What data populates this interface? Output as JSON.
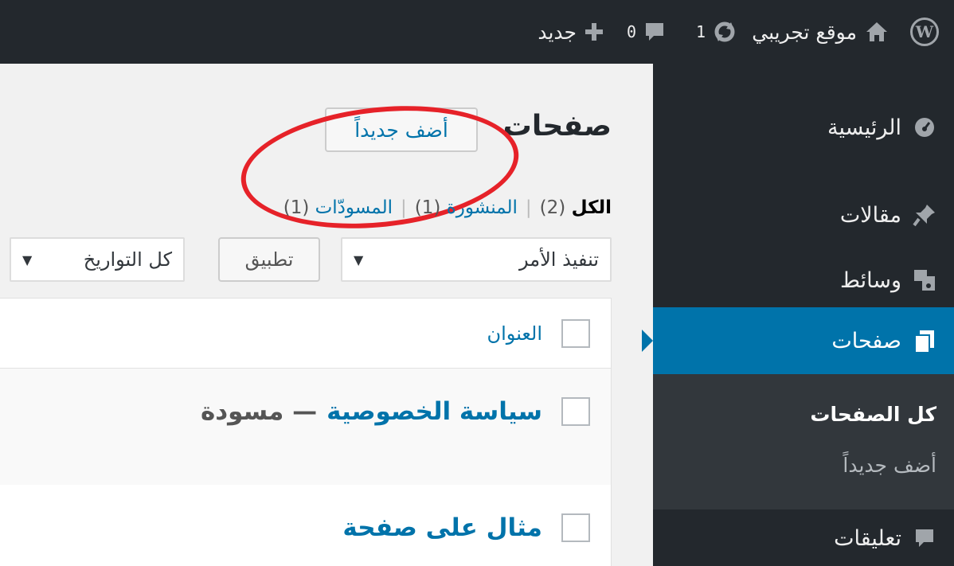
{
  "admin_bar": {
    "site_name": "موقع تجريبي",
    "updates_count": "1",
    "comments_count": "0",
    "new_label": "جديد"
  },
  "sidebar": {
    "dashboard": "الرئيسية",
    "posts": "مقالات",
    "media": "وسائط",
    "pages": "صفحات",
    "submenu": {
      "all_pages": "كل الصفحات",
      "add_new": "أضف جديداً"
    },
    "comments": "تعليقات"
  },
  "main": {
    "title": "صفحات",
    "add_new_button": "أضف جديداً",
    "filters": {
      "all_label": "الكل",
      "all_count": "(2)",
      "published_label": "المنشورة",
      "published_count": "(1)",
      "drafts_label": "المسودّات",
      "drafts_count": "(1)",
      "separator": "|"
    },
    "bulk_action": "تنفيذ الأمر",
    "apply_button": "تطبيق",
    "dates_filter": "كل التواريخ",
    "table": {
      "column_title": "العنوان",
      "rows": [
        {
          "title": "سياسة الخصوصية",
          "state": "— مسودة"
        },
        {
          "title": "مثال على صفحة",
          "state": ""
        }
      ]
    }
  },
  "colors": {
    "admin_bar_bg": "#23282d",
    "accent": "#0073aa",
    "annotation": "#e62229"
  }
}
